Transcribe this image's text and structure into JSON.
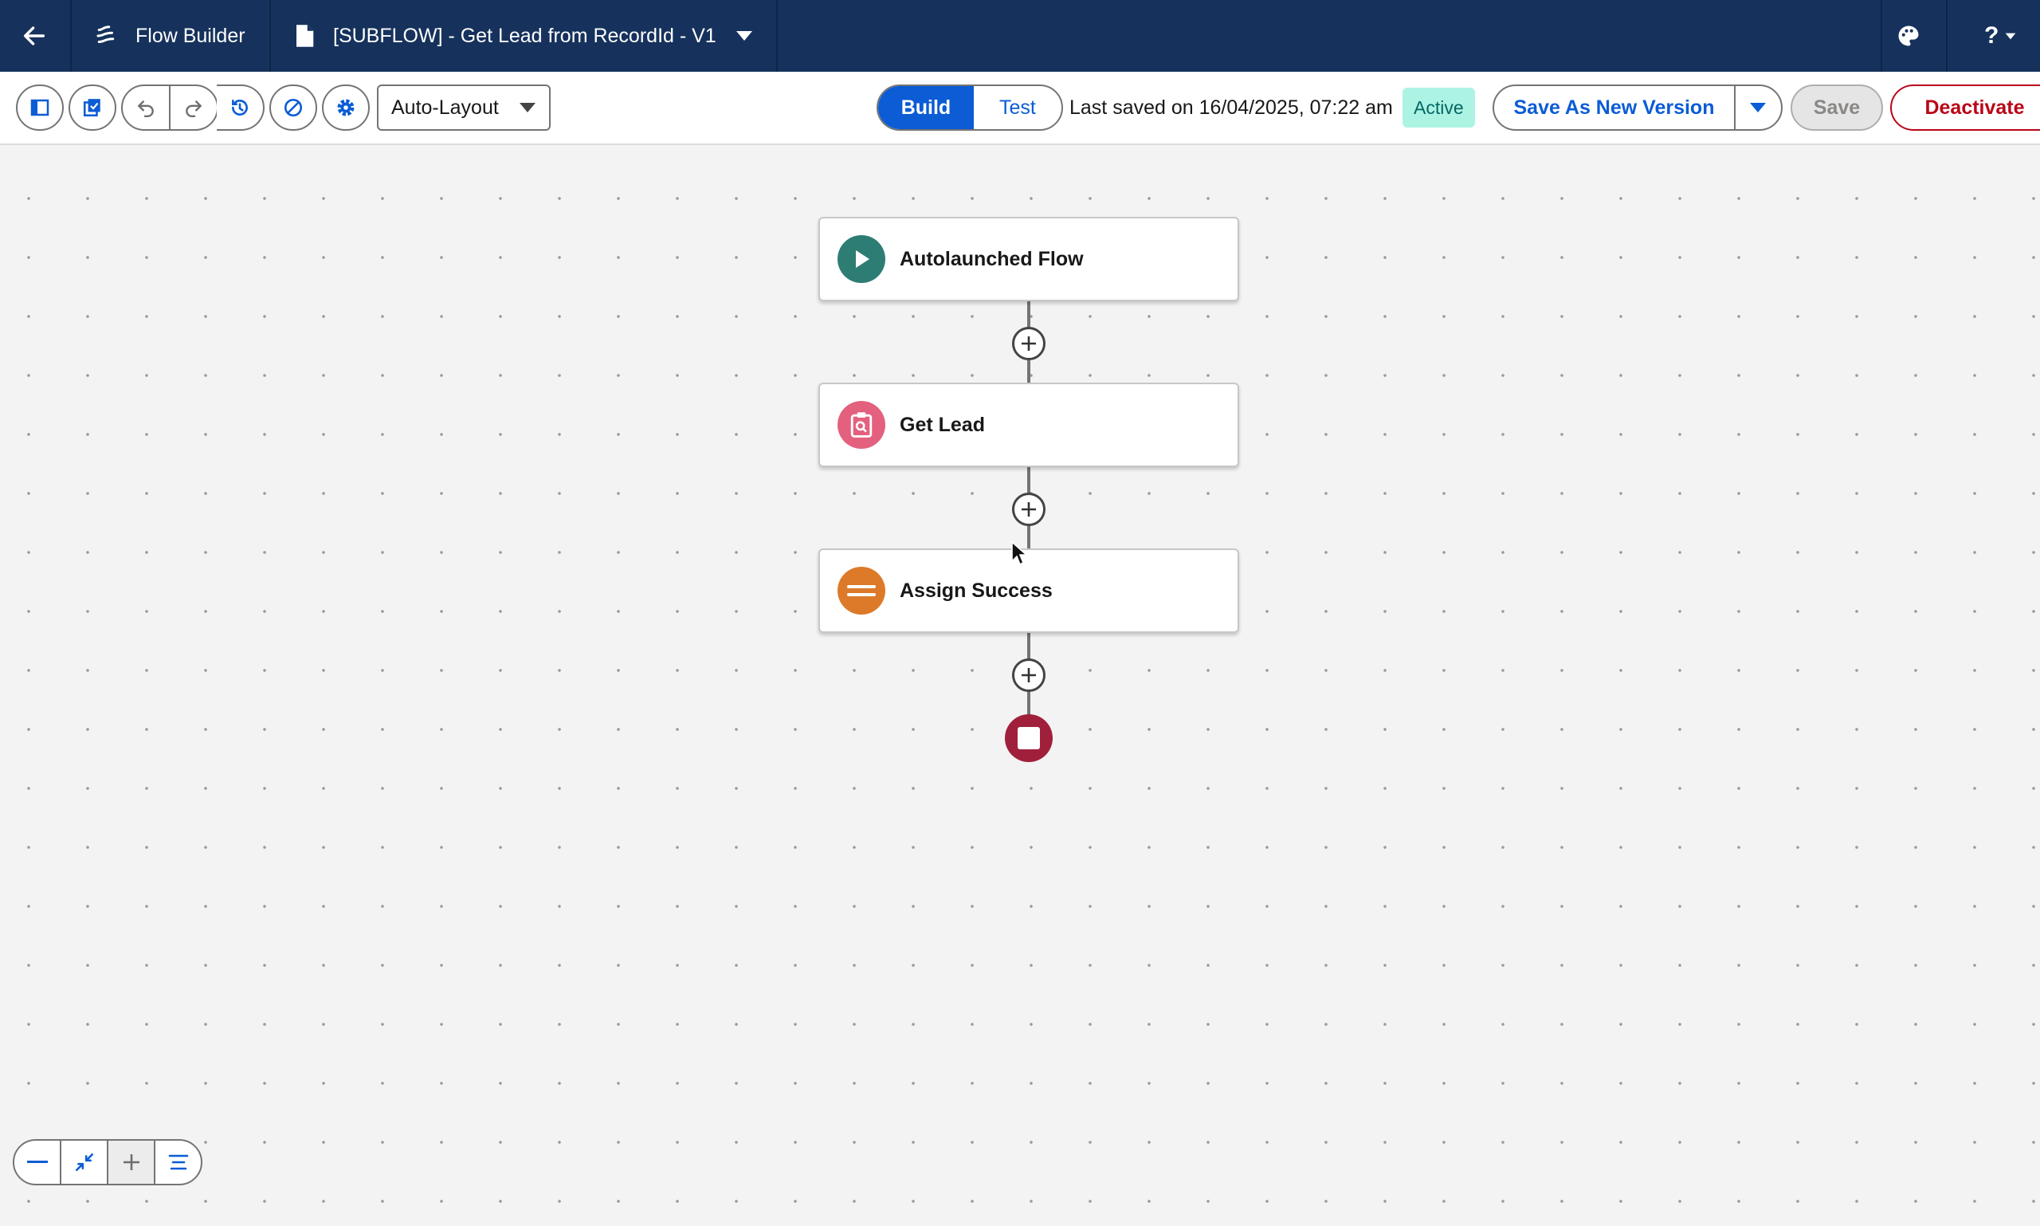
{
  "header": {
    "app_title": "Flow Builder",
    "flow_name": "[SUBFLOW] - Get Lead from RecordId - V1",
    "help_label": "?"
  },
  "toolbar": {
    "layout_select": "Auto-Layout",
    "build_label": "Build",
    "test_label": "Test",
    "last_saved": "Last saved on 16/04/2025, 07:22 am",
    "status_badge": "Active",
    "save_new_version_label": "Save As New Version",
    "save_label": "Save",
    "deactivate_label": "Deactivate"
  },
  "canvas": {
    "nodes": [
      {
        "label": "Autolaunched Flow",
        "icon": "play-icon",
        "color": "#2e7d74"
      },
      {
        "label": "Get Lead",
        "icon": "record-lookup-icon",
        "color": "#e3617f"
      },
      {
        "label": "Assign Success",
        "icon": "assignment-icon",
        "color": "#dd7a2a"
      }
    ],
    "end_icon": "stop-icon",
    "end_color": "#a0203b"
  },
  "colors": {
    "header_bg": "#16325c",
    "brand_blue": "#0b5cd5",
    "active_badge_bg": "#acf3e4",
    "deactivate_red": "#ba0517"
  }
}
